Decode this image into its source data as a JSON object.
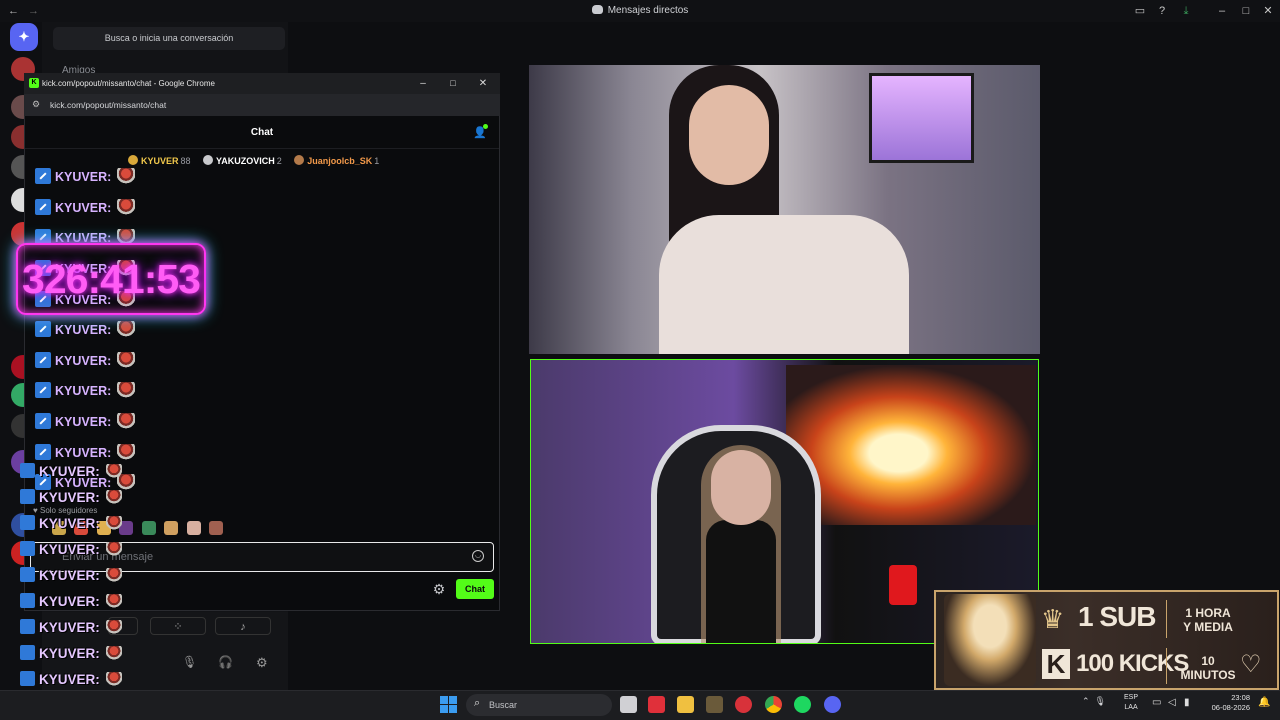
{
  "discord": {
    "window_title": "Mensajes directos",
    "search_placeholder": "Busca o inicia una conversación",
    "friends_label": "Amigos",
    "home_icon": "discord-logo-icon"
  },
  "chrome": {
    "title": "kick.com/popout/missanto/chat - Google Chrome",
    "url": "kick.com/popout/missanto/chat"
  },
  "chat": {
    "title": "Chat",
    "leaderboard": [
      {
        "name": "KYUVER",
        "count": "88",
        "color": "#f2c94c",
        "badge_color": "#d9a83a"
      },
      {
        "name": "YAKUZOVICH",
        "count": "2",
        "color": "#ffffff",
        "badge_color": "#c8c9cc"
      },
      {
        "name": "Juanjoolcb_SK",
        "count": "1",
        "color": "#f2994a",
        "badge_color": "#b37a4a"
      }
    ],
    "user": "KYUVER",
    "separator": ":",
    "followers_only": "Solo seguidores",
    "input_placeholder": "Enviar un mensaje",
    "send_label": "Chat"
  },
  "timer": {
    "text": "326:41:53"
  },
  "overlay_user": "KYUVER",
  "overlay_separator": ":",
  "banner": {
    "sub": "1 SUB",
    "time1_line1": "1 HORA",
    "time1_line2": "Y MEDIA",
    "kicks": "100 KICKS",
    "k_logo": "K",
    "time2_line1": "10",
    "time2_line2": "MINUTOS"
  },
  "taskbar": {
    "search_placeholder": "Buscar",
    "lang_line1": "ESP",
    "lang_line2": "LAA",
    "time": "23:08",
    "date": "06-08-2026"
  }
}
